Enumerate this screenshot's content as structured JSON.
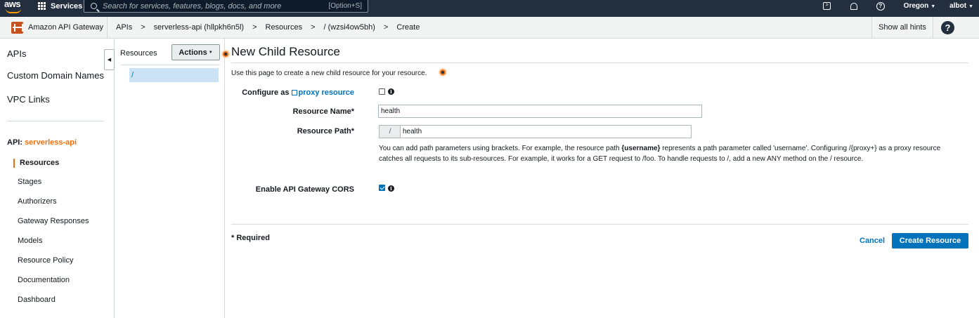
{
  "topnav": {
    "logo_text": "aws",
    "services_label": "Services",
    "search_placeholder": "Search for services, features, blogs, docs, and more",
    "search_shortcut": "[Option+S]",
    "region": "Oregon",
    "user": "albot"
  },
  "breadcrumb": {
    "service_name": "Amazon API Gateway",
    "items": [
      "APIs",
      "serverless-api (hllpkh6n5l)",
      "Resources",
      "/ (wzsi4ow5bh)",
      "Create"
    ],
    "separator": ">",
    "show_hints": "Show all hints",
    "help_glyph": "?"
  },
  "leftnav": {
    "items": [
      "APIs",
      "Custom Domain Names",
      "VPC Links"
    ],
    "api_prefix": "API:",
    "api_name": "serverless-api",
    "sub_items": [
      "Resources",
      "Stages",
      "Authorizers",
      "Gateway Responses",
      "Models",
      "Resource Policy",
      "Documentation",
      "Dashboard"
    ],
    "active_sub_item": "Resources"
  },
  "tree": {
    "title": "Resources",
    "actions_label": "Actions",
    "root_node": "/"
  },
  "form": {
    "title": "New Child Resource",
    "description": "Use this page to create a new child resource for your resource.",
    "proxy_label_prefix": "Configure as",
    "proxy_link": "proxy resource",
    "proxy_checked": false,
    "resource_name_label": "Resource Name*",
    "resource_name_value": "health",
    "resource_path_label": "Resource Path*",
    "resource_path_prefix": "/",
    "resource_path_value": "health",
    "path_help_1": "You can add path parameters using brackets. For example, the resource path ",
    "path_help_bold": "{username}",
    "path_help_2": " represents a path parameter called 'username'. Configuring /{proxy+} as a proxy resource catches all requests to its sub-resources. For example, it works for a GET request to /foo. To handle requests to /, add a new ANY method on the / resource.",
    "cors_label": "Enable API Gateway CORS",
    "cors_checked": true,
    "required_note": "* Required",
    "cancel_label": "Cancel",
    "create_label": "Create Resource",
    "info_glyph": "i"
  },
  "colors": {
    "nav_bg": "#232f3e",
    "accent_orange": "#ec7211",
    "link_blue": "#0073bb",
    "primary_button": "#0073bb"
  }
}
